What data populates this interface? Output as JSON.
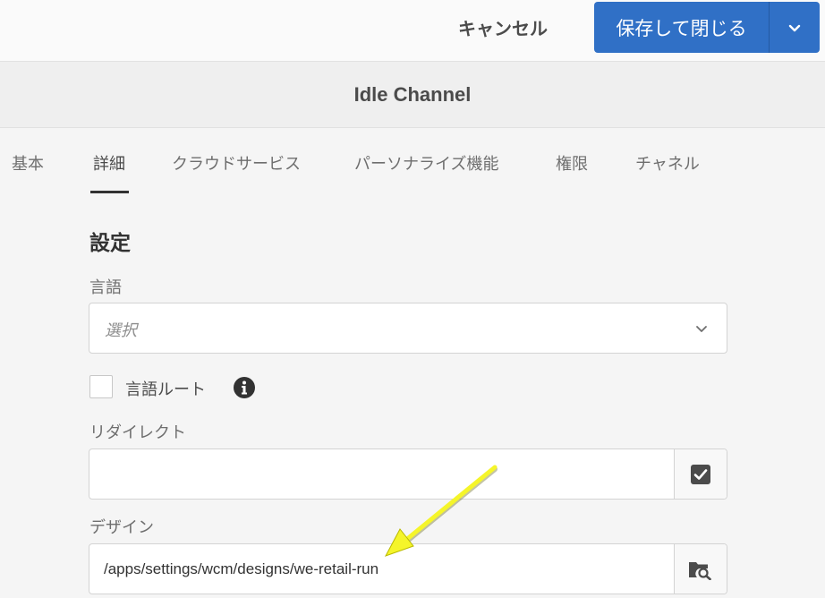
{
  "topbar": {
    "cancel_label": "キャンセル",
    "save_close_label": "保存して閉じる",
    "accent_color": "#3070c6"
  },
  "page": {
    "title": "Idle Channel"
  },
  "tabs": [
    {
      "label": "基本",
      "active": false
    },
    {
      "label": "詳細",
      "active": true
    },
    {
      "label": "クラウドサービス",
      "active": false
    },
    {
      "label": "パーソナライズ機能",
      "active": false
    },
    {
      "label": "権限",
      "active": false
    },
    {
      "label": "チャネル",
      "active": false
    }
  ],
  "form": {
    "section_heading": "設定",
    "language": {
      "label": "言語",
      "placeholder": "選択"
    },
    "language_root": {
      "label": "言語ルート",
      "checked": false,
      "icon": "info-icon"
    },
    "redirect": {
      "label": "リダイレクト",
      "value": "",
      "button_icon": "check-square-icon"
    },
    "design": {
      "label": "デザイン",
      "value": "/apps/settings/wcm/designs/we-retail-run",
      "button_icon": "folder-search-icon"
    }
  },
  "annotation": {
    "arrow_color": "#f5f52a"
  }
}
